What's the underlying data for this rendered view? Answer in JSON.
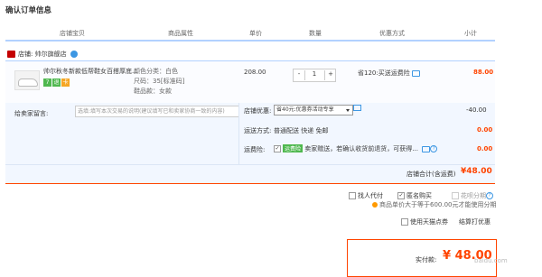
{
  "page": {
    "title": "确认订单信息"
  },
  "headers": [
    "店铺宝贝",
    "商品属性",
    "单价",
    "数量",
    "优惠方式",
    "小计"
  ],
  "store": {
    "label": "店铺:",
    "name": "帅尔旗舰店"
  },
  "item": {
    "name": "帅尔秋冬新款低帮鞋女百搭厚底...",
    "attrs": [
      "颜色分类：白色",
      "尺码：35[标准码]",
      "鞋品款：女款"
    ],
    "price": "208.00",
    "qty_minus": "-",
    "qty": "1",
    "qty_plus": "+",
    "promo": "省120:买送运费险",
    "subtotal": "88.00",
    "badges": [
      "7",
      "退",
      "卡"
    ]
  },
  "memo": {
    "label": "给卖家留言:",
    "placeholder": "选填:填写本次交易的说明(建议填写已和卖家协商一致的内容)"
  },
  "discount": {
    "label": "店铺优惠:",
    "value": "省40元:优惠券活动专享",
    "amount": "-40.00"
  },
  "shipping": {
    "label": "运送方式:",
    "value": "普通配送 快递 免邮",
    "amount": "0.00"
  },
  "insurance": {
    "label": "运费险:",
    "tag": "运费险",
    "text": "卖家赠送，若确认收货前退货，可获得...",
    "amount": "0.00",
    "chk": "✓"
  },
  "store_total": {
    "label": "店铺合计(含运费)",
    "value": "¥48.00"
  },
  "options": {
    "proxy": "找人代付",
    "anonymous": "匿名购买",
    "anon_check": "✓",
    "installment": "花呗分期",
    "installment_note": "商品单价大于等于600.00元才能使用分期"
  },
  "tmall_coupon": "使用天猫点券",
  "calc_link": "结算打优惠",
  "payment": {
    "label": "实付款:",
    "value": "¥ 48.00"
  },
  "watermark": "baidu.com"
}
